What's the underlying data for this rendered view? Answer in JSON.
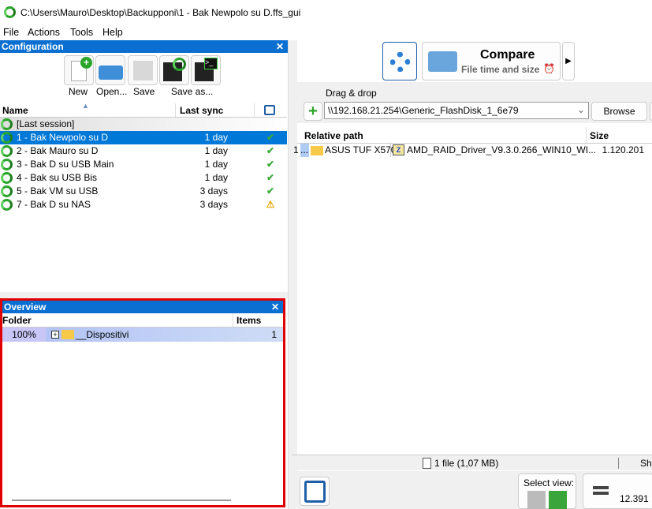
{
  "window": {
    "title": "C:\\Users\\Mauro\\Desktop\\Backupponi\\1 - Bak Newpolo su D.ffs_gui"
  },
  "menu": [
    "File",
    "Actions",
    "Tools",
    "Help"
  ],
  "config": {
    "title": "Configuration",
    "toolbar": {
      "new": "New",
      "open": "Open...",
      "save": "Save",
      "save_as": "Save as..."
    },
    "columns": {
      "name": "Name",
      "last_sync": "Last sync"
    },
    "last_session": "[Last session]",
    "items": [
      {
        "name": "1 - Bak Newpolo su D",
        "last_sync": "1 day",
        "status": "ok",
        "selected": true
      },
      {
        "name": "2 - Bak Mauro su D",
        "last_sync": "1 day",
        "status": "ok"
      },
      {
        "name": "3 - Bak D su USB Main",
        "last_sync": "1 day",
        "status": "ok"
      },
      {
        "name": "4 - Bak su USB Bis",
        "last_sync": "1 day",
        "status": "ok"
      },
      {
        "name": "5 - Bak VM su USB",
        "last_sync": "3 days",
        "status": "ok"
      },
      {
        "name": "7 - Bak D su NAS",
        "last_sync": "3 days",
        "status": "warning"
      }
    ]
  },
  "overview": {
    "title": "Overview",
    "columns": {
      "folder": "Folder",
      "items": "Items"
    },
    "rows": [
      {
        "percent": "100%",
        "folder": "__Dispositivi",
        "items": "1"
      }
    ]
  },
  "compare": {
    "label": "Compare",
    "sub": "File time and size"
  },
  "folder_pair": {
    "drag_drop": "Drag & drop",
    "path": "\\\\192.168.21.254\\Generic_FlashDisk_1_6e79",
    "browse": "Browse"
  },
  "grid": {
    "columns": {
      "relative_path": "Relative path",
      "size": "Size"
    },
    "rows": [
      {
        "index": "1",
        "ellipsis": "...",
        "folder": "ASUS TUF X570",
        "file": "AMD_RAID_Driver_V9.3.0.266_WIN10_WI...",
        "size": "1.120.201"
      }
    ]
  },
  "status": {
    "files": "1 file (1,07 MB)",
    "right": "Sh"
  },
  "bottom": {
    "select_view": "Select view:",
    "count": "12.391"
  },
  "colors": {
    "accent": "#0a6fd0",
    "selection": "#0078d7",
    "highlight": "#e00000"
  }
}
